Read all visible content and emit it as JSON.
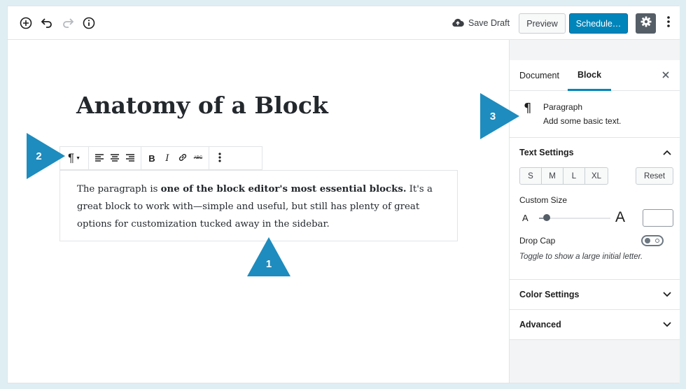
{
  "toolbar": {
    "save_draft_label": "Save Draft",
    "preview_label": "Preview",
    "schedule_label": "Schedule…",
    "icons": [
      "add-block-icon",
      "undo-icon",
      "redo-icon",
      "info-icon",
      "cloud-upload-icon",
      "gear-icon",
      "more-vertical-icon"
    ]
  },
  "editor": {
    "title": "Anatomy of a Block",
    "paragraph": {
      "before": "The paragraph is ",
      "bold": "one of the block editor's most essential blocks.",
      "after": " It's a great block to work with—simple and useful, but still has plenty of great options for customization tucked away in the sidebar."
    },
    "block_toolbar": {
      "paragraph_symbol": "¶",
      "bold": "B",
      "italic": "I",
      "strikethrough": "ABC"
    }
  },
  "callouts": {
    "one": "1",
    "two": "2",
    "three": "3",
    "color": "#1e8cbe"
  },
  "sidebar": {
    "tabs": [
      "Document",
      "Block"
    ],
    "active_tab": "Block",
    "block_card": {
      "icon": "¶",
      "title": "Paragraph",
      "description": "Add some basic text."
    },
    "text_settings": {
      "title": "Text Settings",
      "sizes": [
        "S",
        "M",
        "L",
        "XL"
      ],
      "reset_label": "Reset",
      "custom_size_label": "Custom Size",
      "range_small_label": "A",
      "range_large_label": "A",
      "drop_cap_label": "Drop Cap",
      "drop_cap_help": "Toggle to show a large initial letter."
    },
    "panels": [
      {
        "title": "Color Settings"
      },
      {
        "title": "Advanced"
      }
    ]
  },
  "colors": {
    "primary": "#0085ba",
    "dark_button": "#555d66",
    "callout": "#1e8cbe"
  }
}
